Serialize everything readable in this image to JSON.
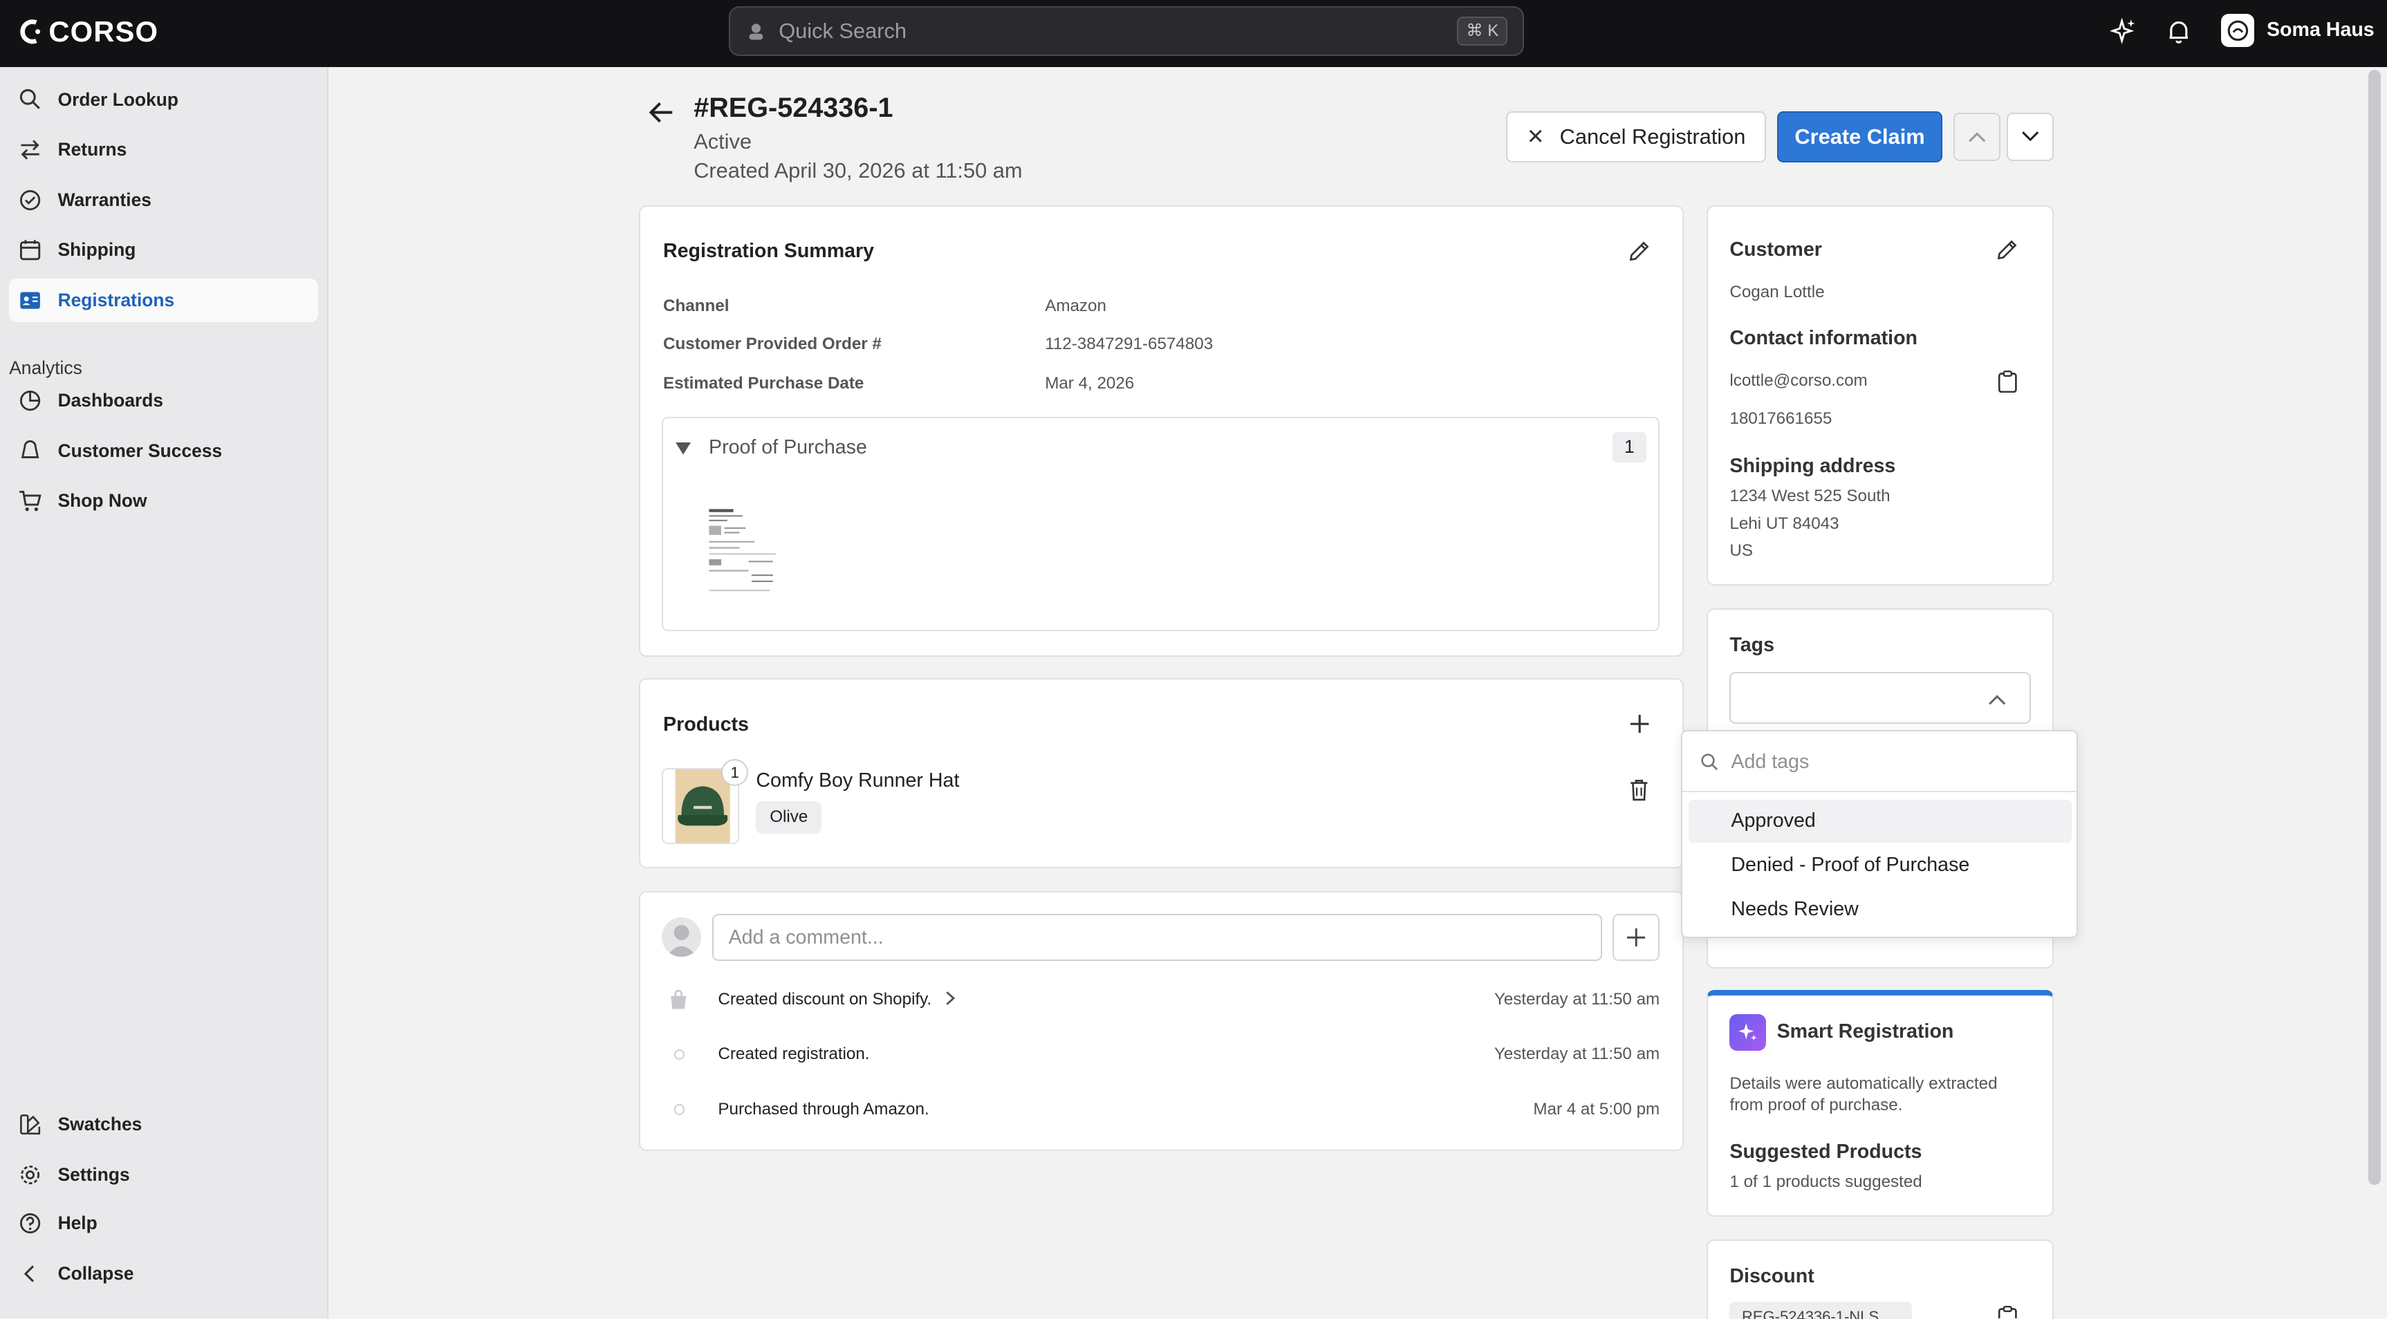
{
  "app": {
    "brand": "CORSO"
  },
  "topbar": {
    "search_placeholder": "Quick Search",
    "search_shortcut": "⌘ K",
    "user_name": "Soma Haus"
  },
  "sidebar": {
    "items": [
      {
        "label": "Order Lookup",
        "icon": "search-icon"
      },
      {
        "label": "Returns",
        "icon": "swap-arrows-icon"
      },
      {
        "label": "Warranties",
        "icon": "check-badge-icon"
      },
      {
        "label": "Shipping",
        "icon": "calendar-icon"
      },
      {
        "label": "Registrations",
        "icon": "id-card-icon",
        "active": true
      }
    ],
    "analytics_label": "Analytics",
    "analytics_items": [
      {
        "label": "Dashboards",
        "icon": "pie-chart-icon"
      },
      {
        "label": "Customer Success",
        "icon": "bell-icon"
      },
      {
        "label": "Shop Now",
        "icon": "cart-icon"
      }
    ],
    "bottom_items": [
      {
        "label": "Swatches",
        "icon": "swatches-icon"
      },
      {
        "label": "Settings",
        "icon": "gear-icon"
      },
      {
        "label": "Help",
        "icon": "help-icon"
      },
      {
        "label": "Collapse",
        "icon": "chevron-left-icon"
      }
    ]
  },
  "header": {
    "title": "#REG-524336-1",
    "status": "Active",
    "created": "Created April 30, 2026 at 11:50 am",
    "cancel_label": "Cancel Registration",
    "claim_label": "Create Claim"
  },
  "summary": {
    "title": "Registration Summary",
    "rows": [
      {
        "label": "Channel",
        "value": "Amazon"
      },
      {
        "label": "Customer Provided Order #",
        "value": "112-3847291-6574803"
      },
      {
        "label": "Estimated Purchase Date",
        "value": "Mar 4, 2026"
      }
    ],
    "proof_label": "Proof of Purchase",
    "proof_count": "1"
  },
  "products": {
    "title": "Products",
    "items": [
      {
        "name": "Comfy Boy Runner Hat",
        "variant": "Olive",
        "quantity": "1"
      }
    ]
  },
  "activity": {
    "comment_placeholder": "Add a comment...",
    "events": [
      {
        "text": "Created discount on Shopify.",
        "time": "Yesterday at 11:50 am"
      },
      {
        "text": "Created registration.",
        "time": "Yesterday at 11:50 am"
      },
      {
        "text": "Purchased through Amazon.",
        "time": "Mar 4 at 5:00 pm"
      }
    ]
  },
  "customer": {
    "title": "Customer",
    "name": "Cogan Lottle",
    "contact_title": "Contact information",
    "email": "lcottle@corso.com",
    "phone": "18017661655",
    "shipping_title": "Shipping address",
    "address_lines": [
      "1234 West 525 South",
      "Lehi UT 84043",
      "US"
    ]
  },
  "tags": {
    "title": "Tags",
    "search_placeholder": "Add tags",
    "options": [
      "Approved",
      "Denied - Proof of Purchase",
      "Needs Review"
    ],
    "highlighted": "Approved"
  },
  "smart_registration": {
    "title": "Smart Registration",
    "description": "Details were automatically extracted from proof of purchase.",
    "suggested_title": "Suggested Products",
    "suggested_text": "1 of 1 products suggested"
  },
  "discount": {
    "title": "Discount",
    "code": "REG-524336-1-NLS"
  },
  "colors": {
    "accent": "#2d77d6",
    "topbar": "#121214",
    "sidebar": "#e9e9eb",
    "active_nav_text": "#1f63b6"
  }
}
